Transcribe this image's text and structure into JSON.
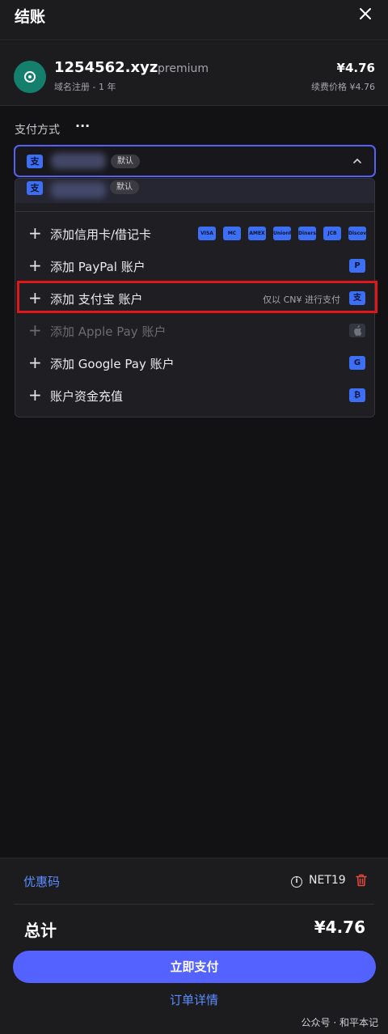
{
  "header": {
    "title": "结账",
    "close_icon": "close-icon"
  },
  "product": {
    "name": "1254562.xyz",
    "tier": "premium",
    "subtitle": "域名注册 - 1 年",
    "price": "¥4.76",
    "renewal": "续费价格 ¥4.76",
    "logo_icon": "domain-logo-icon",
    "logo_color": "#157f6e"
  },
  "payment": {
    "label": "支付方式",
    "more": "···",
    "selected": {
      "icon": "alipay-icon",
      "glyph": "支",
      "badge": "默认"
    },
    "saved": {
      "glyph": "支",
      "badge": "默认"
    },
    "options": [
      {
        "label": "添加信用卡/借记卡",
        "enabled": true,
        "cards": [
          "VISA",
          "MC",
          "AMEX",
          "UnionPay",
          "Diners",
          "JCB",
          "Discover"
        ]
      },
      {
        "label": "添加 PayPal 账户",
        "enabled": true,
        "glyph": "P"
      },
      {
        "label": "添加 支付宝 账户",
        "enabled": true,
        "note": "仅以 CN¥ 进行支付",
        "glyph": "支"
      },
      {
        "label": "添加 Apple Pay 账户",
        "enabled": false,
        "glyph": ""
      },
      {
        "label": "添加 Google Pay 账户",
        "enabled": true,
        "glyph": "G"
      },
      {
        "label": "账户资金充值",
        "enabled": true,
        "glyph": "₿"
      }
    ],
    "plus_glyph": "+"
  },
  "footer": {
    "coupon_label": "优惠码",
    "coupon_code": "NET19",
    "info_glyph": "i",
    "total_label": "总计",
    "total_value": "¥4.76",
    "pay_button": "立即支付",
    "details_link": "订单详情"
  },
  "watermark": "公众号 · 和平本记",
  "colors": {
    "accent": "#5462ff",
    "link": "#5b8cff",
    "brand_icon": "#3d6ff5",
    "highlight": "#e0161b"
  }
}
